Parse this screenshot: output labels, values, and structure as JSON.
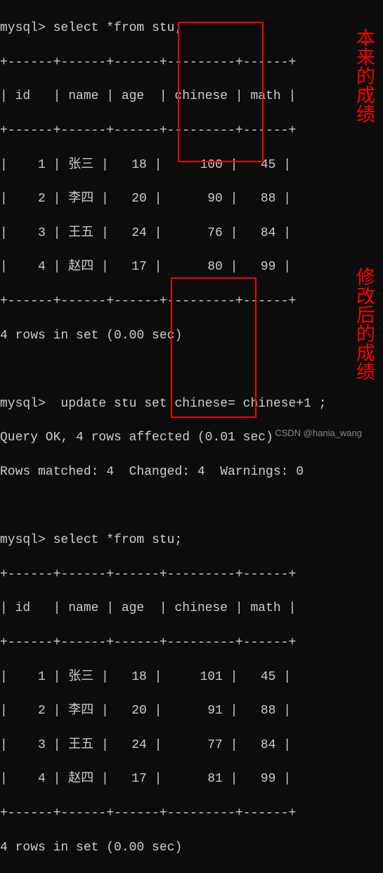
{
  "prompt": "mysql>",
  "query1": " select *from stu;",
  "query2": "  update stu set chinese= chinese+1 ;",
  "query3": " select *from stu;",
  "update_result1": "Query OK, 4 rows affected (0.01 sec)",
  "update_result2": "Rows matched: 4  Changed: 4  Warnings: 0",
  "rows_msg": "4 rows in set (0.00 sec)",
  "table_sep": "+------+------+------+---------+------+",
  "table_header": "| id   | name | age  | chinese | math |",
  "table1": {
    "rows": [
      "|    1 | 张三 |   18 |     100 |   45 |",
      "|    2 | 李四 |   20 |      90 |   88 |",
      "|    3 | 王五 |   24 |      76 |   84 |",
      "|    4 | 赵四 |   17 |      80 |   99 |"
    ]
  },
  "table2": {
    "rows": [
      "|    1 | 张三 |   18 |     101 |   45 |",
      "|    2 | 李四 |   20 |      91 |   88 |",
      "|    3 | 王五 |   24 |      77 |   84 |",
      "|    4 | 赵四 |   17 |      81 |   99 |"
    ]
  },
  "chart_data": {
    "type": "table",
    "tables": [
      {
        "title": "stu (before update)",
        "columns": [
          "id",
          "name",
          "age",
          "chinese",
          "math"
        ],
        "rows": [
          [
            1,
            "张三",
            18,
            100,
            45
          ],
          [
            2,
            "李四",
            20,
            90,
            88
          ],
          [
            3,
            "王五",
            24,
            76,
            84
          ],
          [
            4,
            "赵四",
            17,
            80,
            99
          ]
        ]
      },
      {
        "title": "stu (after update chinese=chinese+1)",
        "columns": [
          "id",
          "name",
          "age",
          "chinese",
          "math"
        ],
        "rows": [
          [
            1,
            "张三",
            18,
            101,
            45
          ],
          [
            2,
            "李四",
            20,
            91,
            88
          ],
          [
            3,
            "王五",
            24,
            77,
            84
          ],
          [
            4,
            "赵四",
            17,
            81,
            99
          ]
        ]
      }
    ]
  },
  "annotation1": "本来的成绩",
  "annotation2": "修改后的成绩",
  "watermark": "CSDN @hania_wang"
}
